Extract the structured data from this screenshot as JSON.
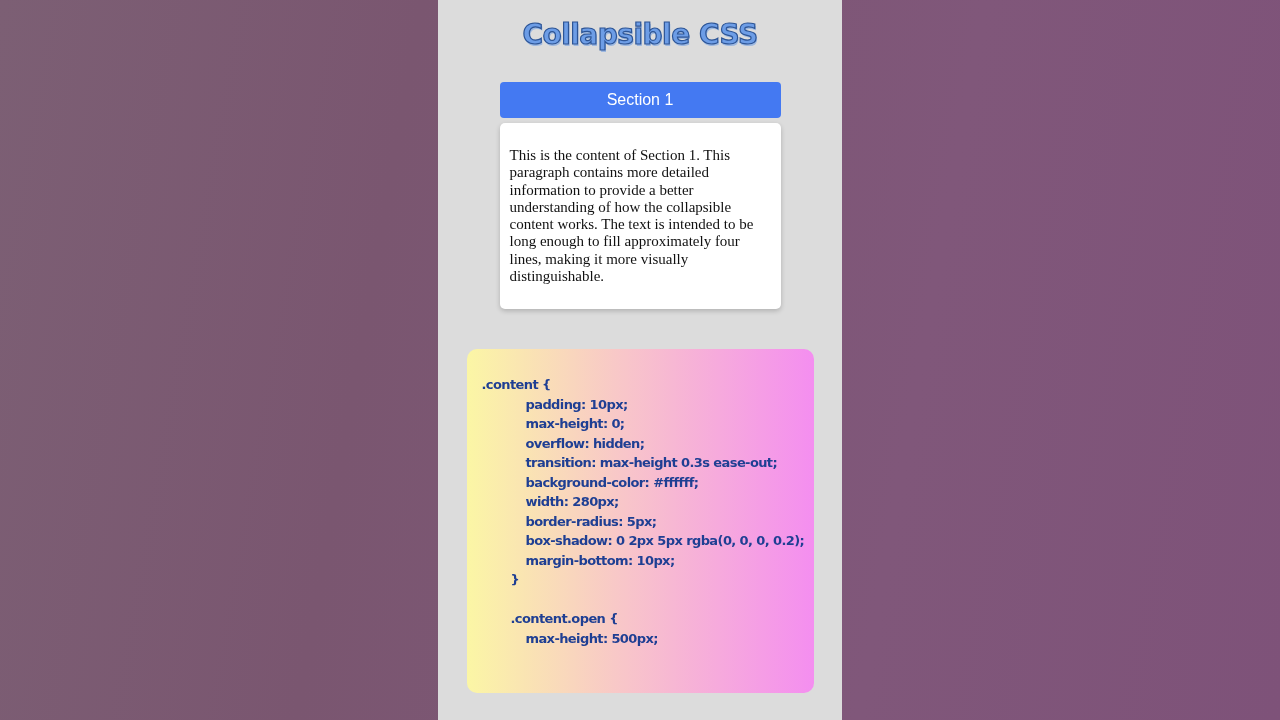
{
  "title": "Collapsible CSS",
  "section": {
    "label": "Section 1",
    "open": true,
    "content": "This is the content of Section 1. This paragraph contains more detailed information to provide a better understanding of how the collapsible content works. The text is intended to be long enough to fill approximately four lines, making it more visually distinguishable."
  },
  "code_lines": [
    {
      "kind": "selector",
      "text": ".content {"
    },
    {
      "kind": "declaration",
      "text": "padding: 10px;"
    },
    {
      "kind": "declaration",
      "text": "max-height: 0;"
    },
    {
      "kind": "declaration",
      "text": "overflow: hidden;"
    },
    {
      "kind": "declaration",
      "text": "transition: max-height 0.3s ease-out;"
    },
    {
      "kind": "declaration",
      "text": "background-color: #ffffff;"
    },
    {
      "kind": "declaration",
      "text": "width: 280px;"
    },
    {
      "kind": "declaration",
      "text": "border-radius: 5px;"
    },
    {
      "kind": "declaration",
      "text": "box-shadow: 0 2px 5px rgba(0, 0, 0, 0.2);"
    },
    {
      "kind": "declaration",
      "text": "margin-bottom: 10px;"
    },
    {
      "kind": "brace",
      "text": "}"
    },
    {
      "kind": "nested-selector",
      "text": ".content.open {"
    },
    {
      "kind": "declaration",
      "text": "max-height: 500px;"
    }
  ]
}
